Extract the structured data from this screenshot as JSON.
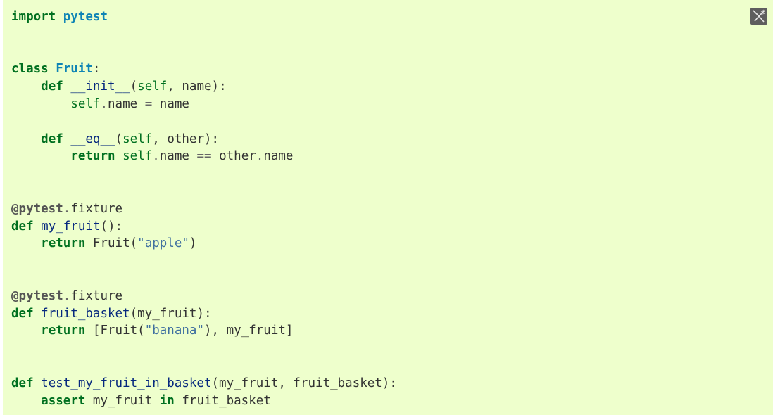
{
  "code": {
    "language": "python",
    "lines": [
      [
        {
          "t": "import",
          "c": "k"
        },
        {
          "t": " ",
          "c": ""
        },
        {
          "t": "pytest",
          "c": "nn"
        }
      ],
      [],
      [],
      [
        {
          "t": "class",
          "c": "k"
        },
        {
          "t": " ",
          "c": ""
        },
        {
          "t": "Fruit",
          "c": "nc"
        },
        {
          "t": ":",
          "c": "p"
        }
      ],
      [
        {
          "t": "    ",
          "c": ""
        },
        {
          "t": "def",
          "c": "k"
        },
        {
          "t": " ",
          "c": ""
        },
        {
          "t": "__init__",
          "c": "fm"
        },
        {
          "t": "(",
          "c": "p"
        },
        {
          "t": "self",
          "c": "bp"
        },
        {
          "t": ", ",
          "c": "p"
        },
        {
          "t": "name",
          "c": "n"
        },
        {
          "t": "):",
          "c": "p"
        }
      ],
      [
        {
          "t": "        ",
          "c": ""
        },
        {
          "t": "self",
          "c": "bp"
        },
        {
          "t": ".",
          "c": "o"
        },
        {
          "t": "name",
          "c": "n"
        },
        {
          "t": " ",
          "c": ""
        },
        {
          "t": "=",
          "c": "o"
        },
        {
          "t": " ",
          "c": ""
        },
        {
          "t": "name",
          "c": "n"
        }
      ],
      [],
      [
        {
          "t": "    ",
          "c": ""
        },
        {
          "t": "def",
          "c": "k"
        },
        {
          "t": " ",
          "c": ""
        },
        {
          "t": "__eq__",
          "c": "fm"
        },
        {
          "t": "(",
          "c": "p"
        },
        {
          "t": "self",
          "c": "bp"
        },
        {
          "t": ", ",
          "c": "p"
        },
        {
          "t": "other",
          "c": "n"
        },
        {
          "t": "):",
          "c": "p"
        }
      ],
      [
        {
          "t": "        ",
          "c": ""
        },
        {
          "t": "return",
          "c": "k"
        },
        {
          "t": " ",
          "c": ""
        },
        {
          "t": "self",
          "c": "bp"
        },
        {
          "t": ".",
          "c": "o"
        },
        {
          "t": "name",
          "c": "n"
        },
        {
          "t": " ",
          "c": ""
        },
        {
          "t": "==",
          "c": "o"
        },
        {
          "t": " ",
          "c": ""
        },
        {
          "t": "other",
          "c": "n"
        },
        {
          "t": ".",
          "c": "o"
        },
        {
          "t": "name",
          "c": "n"
        }
      ],
      [],
      [],
      [
        {
          "t": "@pytest",
          "c": "nd"
        },
        {
          "t": ".",
          "c": "o"
        },
        {
          "t": "fixture",
          "c": "n"
        }
      ],
      [
        {
          "t": "def",
          "c": "k"
        },
        {
          "t": " ",
          "c": ""
        },
        {
          "t": "my_fruit",
          "c": "nf"
        },
        {
          "t": "():",
          "c": "p"
        }
      ],
      [
        {
          "t": "    ",
          "c": ""
        },
        {
          "t": "return",
          "c": "k"
        },
        {
          "t": " ",
          "c": ""
        },
        {
          "t": "Fruit",
          "c": "n"
        },
        {
          "t": "(",
          "c": "p"
        },
        {
          "t": "\"apple\"",
          "c": "s2"
        },
        {
          "t": ")",
          "c": "p"
        }
      ],
      [],
      [],
      [
        {
          "t": "@pytest",
          "c": "nd"
        },
        {
          "t": ".",
          "c": "o"
        },
        {
          "t": "fixture",
          "c": "n"
        }
      ],
      [
        {
          "t": "def",
          "c": "k"
        },
        {
          "t": " ",
          "c": ""
        },
        {
          "t": "fruit_basket",
          "c": "nf"
        },
        {
          "t": "(",
          "c": "p"
        },
        {
          "t": "my_fruit",
          "c": "n"
        },
        {
          "t": "):",
          "c": "p"
        }
      ],
      [
        {
          "t": "    ",
          "c": ""
        },
        {
          "t": "return",
          "c": "k"
        },
        {
          "t": " ",
          "c": ""
        },
        {
          "t": "[",
          "c": "p"
        },
        {
          "t": "Fruit",
          "c": "n"
        },
        {
          "t": "(",
          "c": "p"
        },
        {
          "t": "\"banana\"",
          "c": "s2"
        },
        {
          "t": "), ",
          "c": "p"
        },
        {
          "t": "my_fruit",
          "c": "n"
        },
        {
          "t": "]",
          "c": "p"
        }
      ],
      [],
      [],
      [
        {
          "t": "def",
          "c": "k"
        },
        {
          "t": " ",
          "c": ""
        },
        {
          "t": "test_my_fruit_in_basket",
          "c": "nf"
        },
        {
          "t": "(",
          "c": "p"
        },
        {
          "t": "my_fruit",
          "c": "n"
        },
        {
          "t": ", ",
          "c": "p"
        },
        {
          "t": "fruit_basket",
          "c": "n"
        },
        {
          "t": "):",
          "c": "p"
        }
      ],
      [
        {
          "t": "    ",
          "c": ""
        },
        {
          "t": "assert",
          "c": "k"
        },
        {
          "t": " ",
          "c": ""
        },
        {
          "t": "my_fruit",
          "c": "n"
        },
        {
          "t": " ",
          "c": ""
        },
        {
          "t": "in",
          "c": "ow"
        },
        {
          "t": " ",
          "c": ""
        },
        {
          "t": "fruit_basket",
          "c": "n"
        }
      ]
    ]
  },
  "copy_button": {
    "icon": "copy-icon"
  },
  "colors": {
    "background": "#eeffcc",
    "keyword": "#007020",
    "namespace": "#0e84b5",
    "function": "#06287e",
    "string": "#4070a0",
    "decorator": "#555555"
  }
}
